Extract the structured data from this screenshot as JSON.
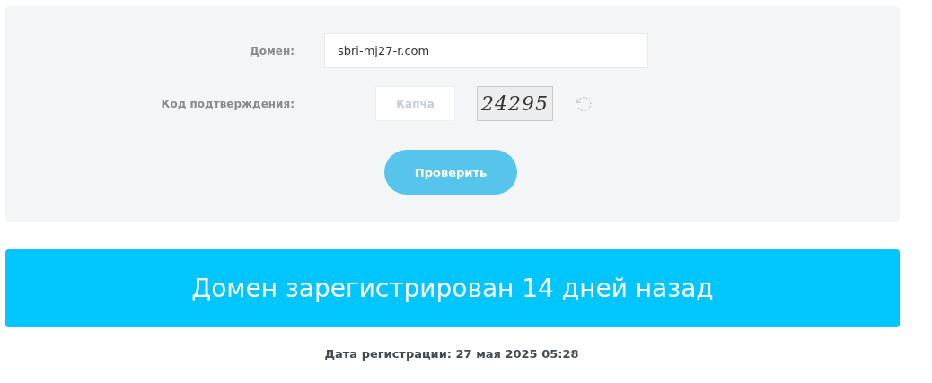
{
  "form": {
    "domain": {
      "label": "Домен:",
      "value": "sbri-mj27-r.com"
    },
    "captcha": {
      "label": "Код подтверждения:",
      "placeholder": "Капча",
      "image_text": "24295"
    },
    "submit": "Проверить"
  },
  "result": {
    "banner": "Домен зарегистрирован 14 дней назад",
    "date_line": "Дата регистрации: 27 мая 2025 05:28"
  }
}
